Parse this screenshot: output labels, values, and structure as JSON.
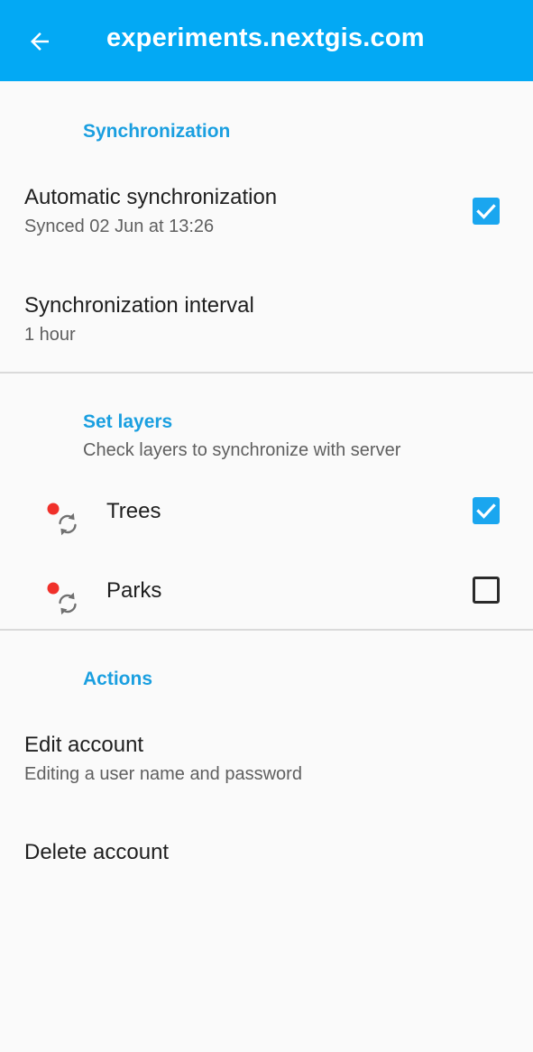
{
  "appbar": {
    "title": "experiments.nextgis.com",
    "back_icon": "arrow-left-icon",
    "color": "#03a9f4"
  },
  "sync_section": {
    "header": "Synchronization",
    "auto_sync": {
      "title": "Automatic synchronization",
      "summary": "Synced 02 Jun at 13:26",
      "checked": true
    },
    "interval": {
      "title": "Synchronization interval",
      "summary": "1 hour"
    }
  },
  "layers_section": {
    "header": "Set layers",
    "summary": "Check layers to synchronize with server",
    "layers": [
      {
        "name": "Trees",
        "checked": true,
        "icon": "sync-layer-icon"
      },
      {
        "name": "Parks",
        "checked": false,
        "icon": "sync-layer-icon"
      }
    ]
  },
  "actions_section": {
    "header": "Actions",
    "edit_account": {
      "title": "Edit account",
      "summary": "Editing a user name and password"
    },
    "delete_account": {
      "title": "Delete account"
    }
  },
  "colors": {
    "accent": "#1aa6ef",
    "category": "#1a9fe0",
    "status_dot": "#f0302a"
  }
}
